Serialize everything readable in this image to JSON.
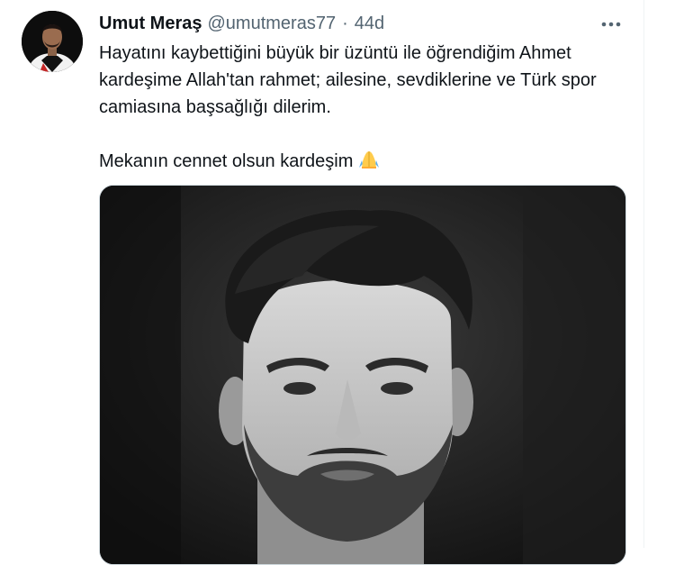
{
  "tweet": {
    "author_name": "Umut Meraş",
    "handle": "@umutmeras77",
    "separator": "·",
    "time": "44d",
    "text_paragraph_1": "Hayatını kaybettiğini büyük bir üzüntü ile öğrendiğim Ahmet kardeşime Allah'tan rahmet; ailesine, sevdiklerine ve Türk spor camiasına başsağlığı dilerim.",
    "text_paragraph_2": "Mekanın cennet olsun kardeşim",
    "emoji": "folded-hands-icon",
    "more_icon": "more-horizontal-icon",
    "media": "black-and-white portrait photo"
  },
  "colors": {
    "text_primary": "#0f1419",
    "text_secondary": "#536471",
    "divider": "#eff3f4",
    "emoji_yellow": "#ffcc4d",
    "emoji_blue": "#5dadec"
  }
}
